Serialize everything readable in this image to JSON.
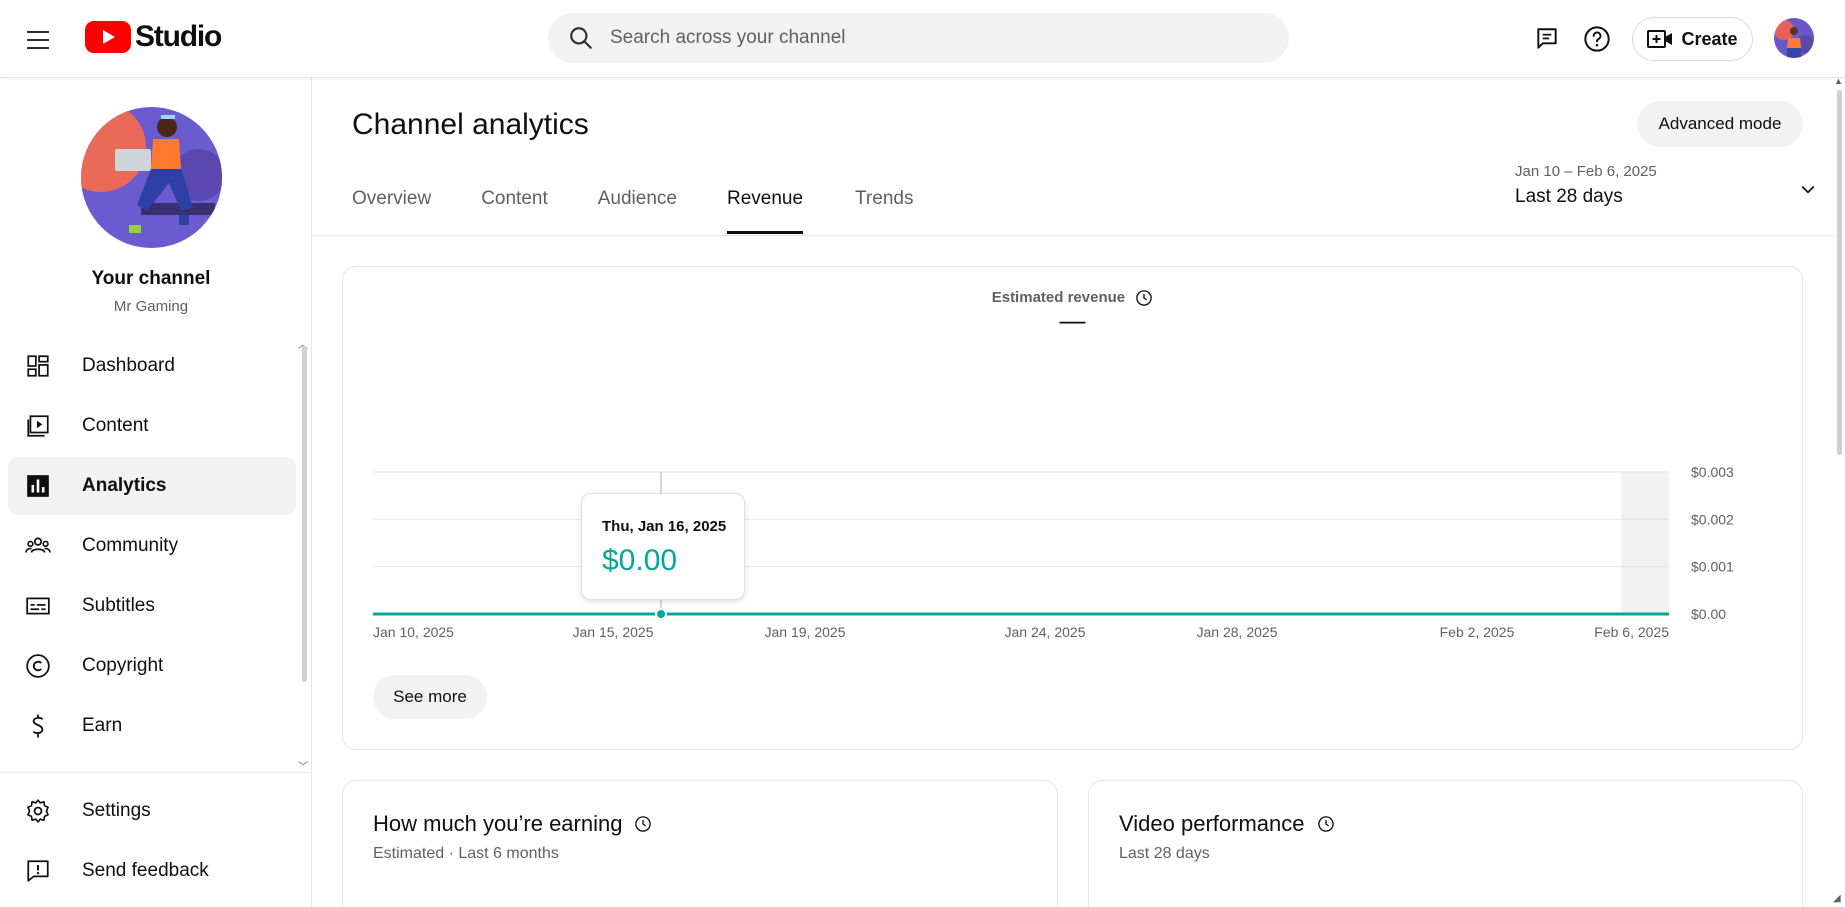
{
  "app": {
    "logo_text": "Studio",
    "search_placeholder": "Search across your channel",
    "create_label": "Create"
  },
  "sidebar": {
    "channel_title": "Your channel",
    "channel_name": "Mr Gaming",
    "items": [
      {
        "label": "Dashboard",
        "icon": "dashboard-icon"
      },
      {
        "label": "Content",
        "icon": "content-icon"
      },
      {
        "label": "Analytics",
        "icon": "analytics-icon",
        "active": true
      },
      {
        "label": "Community",
        "icon": "community-icon"
      },
      {
        "label": "Subtitles",
        "icon": "subtitles-icon"
      },
      {
        "label": "Copyright",
        "icon": "copyright-icon"
      },
      {
        "label": "Earn",
        "icon": "earn-icon"
      }
    ],
    "bottom_items": [
      {
        "label": "Settings",
        "icon": "gear-icon"
      },
      {
        "label": "Send feedback",
        "icon": "feedback-icon"
      }
    ]
  },
  "main": {
    "title": "Channel analytics",
    "advanced_mode_label": "Advanced mode",
    "tabs": [
      {
        "label": "Overview"
      },
      {
        "label": "Content"
      },
      {
        "label": "Audience"
      },
      {
        "label": "Revenue",
        "active": true
      },
      {
        "label": "Trends"
      }
    ],
    "date_range": "Jan 10 – Feb 6, 2025",
    "date_label": "Last 28 days"
  },
  "chart_card": {
    "metric_name": "Estimated revenue",
    "metric_value": "—",
    "tooltip_date": "Thu, Jan 16, 2025",
    "tooltip_value": "$0.00",
    "see_more_label": "See more"
  },
  "earning_card": {
    "title": "How much you’re earning",
    "subtitle": "Estimated · Last 6 months"
  },
  "performance_card": {
    "title": "Video performance",
    "subtitle": "Last 28 days"
  },
  "colors": {
    "accent": "#00a89b",
    "brand_red": "#ff0000",
    "text_primary": "#0f0f0f",
    "text_secondary": "#606060"
  },
  "chart_data": {
    "type": "line",
    "title": "Estimated revenue",
    "x": [
      "Jan 10, 2025",
      "Jan 11, 2025",
      "Jan 12, 2025",
      "Jan 13, 2025",
      "Jan 14, 2025",
      "Jan 15, 2025",
      "Jan 16, 2025",
      "Jan 17, 2025",
      "Jan 18, 2025",
      "Jan 19, 2025",
      "Jan 20, 2025",
      "Jan 21, 2025",
      "Jan 22, 2025",
      "Jan 23, 2025",
      "Jan 24, 2025",
      "Jan 25, 2025",
      "Jan 26, 2025",
      "Jan 27, 2025",
      "Jan 28, 2025",
      "Jan 29, 2025",
      "Jan 30, 2025",
      "Jan 31, 2025",
      "Feb 1, 2025",
      "Feb 2, 2025",
      "Feb 3, 2025",
      "Feb 4, 2025",
      "Feb 5, 2025",
      "Feb 6, 2025"
    ],
    "series": [
      {
        "values": [
          0,
          0,
          0,
          0,
          0,
          0,
          0,
          0,
          0,
          0,
          0,
          0,
          0,
          0,
          0,
          0,
          0,
          0,
          0,
          0,
          0,
          0,
          0,
          0,
          0,
          0,
          0,
          0
        ]
      }
    ],
    "x_tick_labels": [
      "Jan 10, 2025",
      "Jan 15, 2025",
      "Jan 19, 2025",
      "Jan 24, 2025",
      "Jan 28, 2025",
      "Feb 2, 2025",
      "Feb 6, 2025"
    ],
    "y_tick_labels": [
      "$0.003",
      "$0.002",
      "$0.001",
      "$0.00"
    ],
    "y_ticks": [
      0.003,
      0.002,
      0.001,
      0
    ],
    "ylim": [
      0,
      0.003
    ],
    "highlighted_point": "Jan 16, 2025",
    "grid": true,
    "y_axis_side": "right"
  }
}
